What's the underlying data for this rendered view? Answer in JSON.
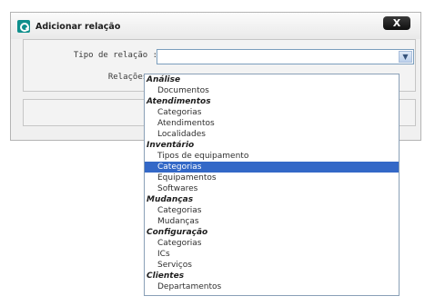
{
  "dialog": {
    "title": "Adicionar relação",
    "close_label": "X"
  },
  "form": {
    "tipo_label": "Tipo de relação :",
    "relacoes_label": "Relações :"
  },
  "select": {
    "value": "",
    "arrow_icon": "chevron-down-icon"
  },
  "dropdown": {
    "groups": [
      {
        "label": "Análise",
        "options": [
          "Documentos"
        ]
      },
      {
        "label": "Atendimentos",
        "options": [
          "Categorias",
          "Atendimentos",
          "Localidades"
        ]
      },
      {
        "label": "Inventário",
        "options": [
          "Tipos de equipamento",
          "Categorias",
          "Equipamentos",
          "Softwares"
        ],
        "selected_index": 1
      },
      {
        "label": "Mudanças",
        "options": [
          "Categorias",
          "Mudanças"
        ]
      },
      {
        "label": "Configuração",
        "options": [
          "Categorias",
          "ICs",
          "Serviços"
        ]
      },
      {
        "label": "Clientes",
        "options": [
          "Departamentos"
        ]
      }
    ]
  },
  "colors": {
    "selection": "#3368c7",
    "logo": "#0f8f8c"
  }
}
